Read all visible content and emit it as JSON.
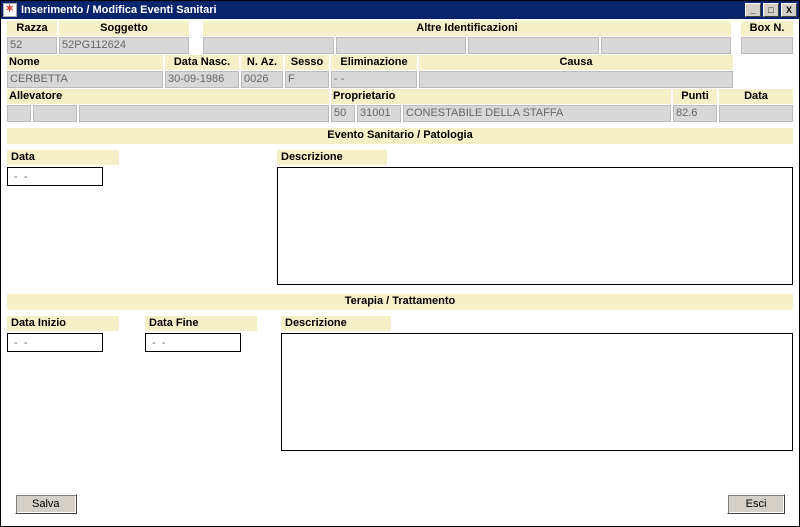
{
  "window": {
    "title": "Inserimento / Modifica Eventi Sanitari"
  },
  "header": {
    "razza": {
      "label": "Razza",
      "value": "52"
    },
    "soggetto": {
      "label": "Soggetto",
      "value": "52PG112624"
    },
    "altre_identificazioni": {
      "label": "Altre Identificazioni",
      "v1": "",
      "v2": "",
      "v3": "",
      "v4": ""
    },
    "box": {
      "label": "Box N.",
      "value": ""
    },
    "nome": {
      "label": "Nome",
      "value": "CERBETTA"
    },
    "data_nasc": {
      "label": "Data Nasc.",
      "value": "30-09-1986"
    },
    "n_az": {
      "label": "N. Az.",
      "value": "0026"
    },
    "sesso": {
      "label": "Sesso",
      "value": "F"
    },
    "eliminazione": {
      "label": "Eliminazione",
      "value": " -  -"
    },
    "causa": {
      "label": "Causa",
      "value": ""
    },
    "allevatore": {
      "label": "Allevatore",
      "cod": "",
      "nome": ""
    },
    "proprietario": {
      "label": "Proprietario",
      "prov": "50",
      "cod": "31001",
      "nome": "CONESTABILE DELLA STAFFA"
    },
    "punti": {
      "label": "Punti",
      "value": "82.6"
    },
    "data": {
      "label": "Data",
      "value": ""
    }
  },
  "sections": {
    "evento": {
      "title": "Evento Sanitario / Patologia",
      "data": {
        "label": "Data",
        "value": " -  -"
      },
      "descrizione": {
        "label": "Descrizione",
        "value": ""
      }
    },
    "terapia": {
      "title": "Terapia / Trattamento",
      "data_inizio": {
        "label": "Data Inizio",
        "value": " -  -"
      },
      "data_fine": {
        "label": "Data Fine",
        "value": " -  -"
      },
      "descrizione": {
        "label": "Descrizione",
        "value": ""
      }
    }
  },
  "buttons": {
    "salva": "Salva",
    "esci": "Esci"
  }
}
